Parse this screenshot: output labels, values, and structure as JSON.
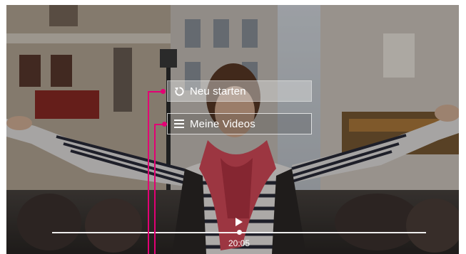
{
  "menu": {
    "restart_label": "Neu starten",
    "videos_label": "Meine Videos"
  },
  "player": {
    "current_time": "20:05",
    "progress": 0.5
  },
  "icons": {
    "restart": "restart-icon",
    "menu": "list-menu-icon",
    "play": "play-icon"
  },
  "colors": {
    "callout": "#e20074"
  }
}
